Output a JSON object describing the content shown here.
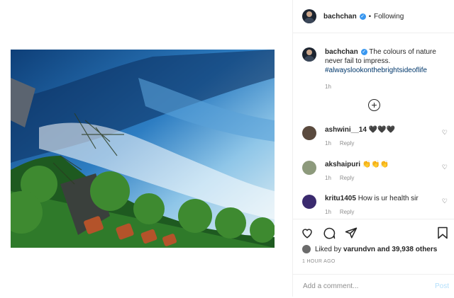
{
  "post": {
    "username": "bachchan",
    "verified_icon": "verified-badge",
    "separator": "•",
    "follow_state": "Following",
    "caption": "The colours of nature never fail to impress.",
    "hashtag": "#alwayslookonthebrightsideoflife",
    "caption_time": "1h",
    "likes_text_prefix": "Liked by",
    "likes_user": "varundvn",
    "likes_rest": "and 39,938 others",
    "time_ago": "1 HOUR AGO",
    "add_comment_placeholder": "Add a comment...",
    "post_label": "Post"
  },
  "comments": [
    {
      "user": "ashwini__14",
      "text": "🖤🖤🖤",
      "time": "1h",
      "reply": "Reply",
      "avatar_color": "#5a4a3e"
    },
    {
      "user": "akshaipuri",
      "text": "👏👏👏",
      "time": "1h",
      "reply": "Reply",
      "avatar_color": "#8d9a7c"
    },
    {
      "user": "kritu1405",
      "text": "How is ur health sir",
      "time": "1h",
      "reply": "Reply",
      "avatar_color": "#3a2a6e"
    }
  ],
  "icons": [
    "heart-icon",
    "comment-icon",
    "share-icon",
    "bookmark-icon",
    "add-icon"
  ]
}
